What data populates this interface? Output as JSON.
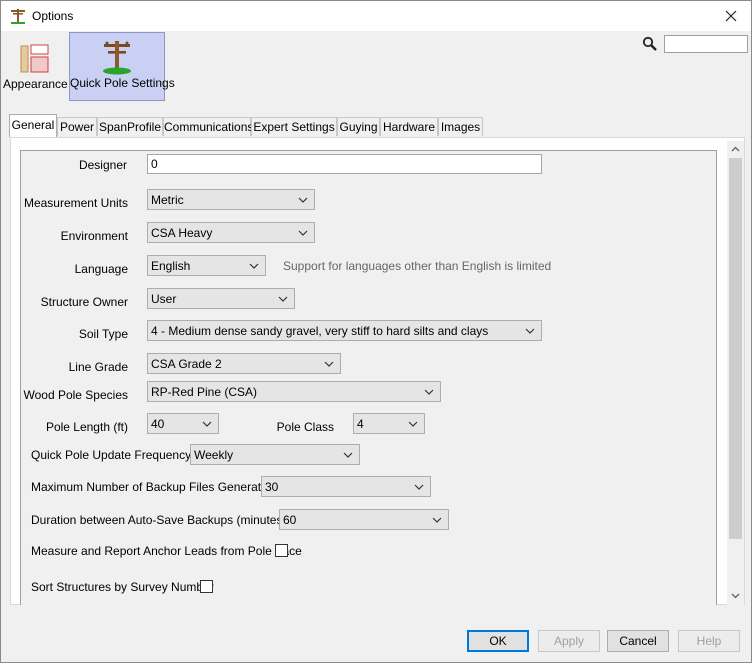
{
  "window": {
    "title": "Options"
  },
  "toolbar": {
    "appearance_label": "Appearance",
    "quick_pole_label": "Quick Pole Settings",
    "search_placeholder": "",
    "search_value": ""
  },
  "tabs": [
    {
      "label": "General",
      "active": true
    },
    {
      "label": "Power"
    },
    {
      "label": "SpanProfile"
    },
    {
      "label": "Communications"
    },
    {
      "label": "Expert Settings"
    },
    {
      "label": "Guying"
    },
    {
      "label": "Hardware"
    },
    {
      "label": "Images"
    }
  ],
  "form": {
    "designer": {
      "label": "Designer",
      "value": "0"
    },
    "measurement_units": {
      "label": "Measurement Units",
      "value": "Metric"
    },
    "environment": {
      "label": "Environment",
      "value": "CSA Heavy"
    },
    "language": {
      "label": "Language",
      "value": "English",
      "hint": "Support for languages other than English is limited"
    },
    "structure_owner": {
      "label": "Structure Owner",
      "value": "User"
    },
    "soil_type": {
      "label": "Soil Type",
      "value": "4 - Medium dense sandy gravel, very stiff to hard silts and clays"
    },
    "line_grade": {
      "label": "Line Grade",
      "value": "CSA Grade 2"
    },
    "wood_pole_species": {
      "label": "Wood Pole Species",
      "value": "RP-Red Pine (CSA)"
    },
    "pole_length": {
      "label": "Pole Length (ft)",
      "value": "40"
    },
    "pole_class": {
      "label": "Pole Class",
      "value": "4"
    },
    "update_frequency": {
      "label": "Quick Pole Update Frequency",
      "value": "Weekly"
    },
    "max_backups": {
      "label": "Maximum Number of Backup Files Generated",
      "value": "30"
    },
    "autosave_duration": {
      "label": "Duration between Auto-Save Backups (minutes)",
      "value": "60"
    },
    "anchor_leads": {
      "label": "Measure and Report Anchor Leads from Pole Face",
      "checked": false
    },
    "sort_structures": {
      "label": "Sort Structures by Survey Number",
      "checked": false
    }
  },
  "buttons": {
    "ok": "OK",
    "apply": "Apply",
    "cancel": "Cancel",
    "help": "Help"
  },
  "colors": {
    "selected_category_bg": "#c9d0f3",
    "default_button_border": "#0078d7"
  }
}
